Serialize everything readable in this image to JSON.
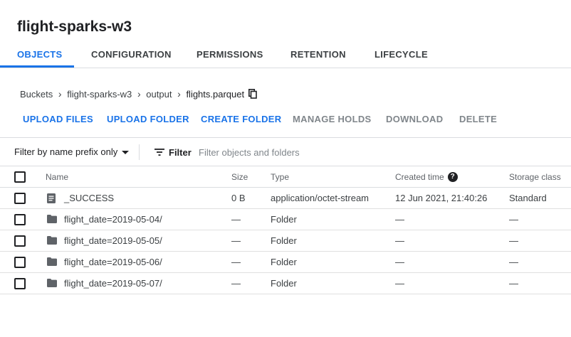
{
  "page": {
    "title": "flight-sparks-w3"
  },
  "tabs": [
    {
      "label": "OBJECTS",
      "active": true
    },
    {
      "label": "CONFIGURATION",
      "active": false
    },
    {
      "label": "PERMISSIONS",
      "active": false
    },
    {
      "label": "RETENTION",
      "active": false
    },
    {
      "label": "LIFECYCLE",
      "active": false
    }
  ],
  "breadcrumb": {
    "items": [
      "Buckets",
      "flight-sparks-w3",
      "output"
    ],
    "current": "flights.parquet"
  },
  "actions": [
    {
      "label": "UPLOAD FILES",
      "enabled": true
    },
    {
      "label": "UPLOAD FOLDER",
      "enabled": true
    },
    {
      "label": "CREATE FOLDER",
      "enabled": true
    },
    {
      "label": "MANAGE HOLDS",
      "enabled": false
    },
    {
      "label": "DOWNLOAD",
      "enabled": false
    },
    {
      "label": "DELETE",
      "enabled": false
    }
  ],
  "filterbar": {
    "prefix_select": "Filter by name prefix only",
    "filter_label": "Filter",
    "placeholder": "Filter objects and folders"
  },
  "table": {
    "columns": {
      "name": "Name",
      "size": "Size",
      "type": "Type",
      "created": "Created time",
      "storage": "Storage class"
    },
    "rows": [
      {
        "icon": "document-icon",
        "name": "_SUCCESS",
        "size": "0 B",
        "type": "application/octet-stream",
        "created": "12 Jun 2021, 21:40:26",
        "storage": "Standard"
      },
      {
        "icon": "folder-icon",
        "name": "flight_date=2019-05-04/",
        "size": "—",
        "type": "Folder",
        "created": "—",
        "storage": "—"
      },
      {
        "icon": "folder-icon",
        "name": "flight_date=2019-05-05/",
        "size": "—",
        "type": "Folder",
        "created": "—",
        "storage": "—"
      },
      {
        "icon": "folder-icon",
        "name": "flight_date=2019-05-06/",
        "size": "—",
        "type": "Folder",
        "created": "—",
        "storage": "—"
      },
      {
        "icon": "folder-icon",
        "name": "flight_date=2019-05-07/",
        "size": "—",
        "type": "Folder",
        "created": "—",
        "storage": "—"
      }
    ]
  },
  "colors": {
    "accent": "#1a73e8",
    "disabled": "#80868b",
    "border": "#dadce0"
  }
}
